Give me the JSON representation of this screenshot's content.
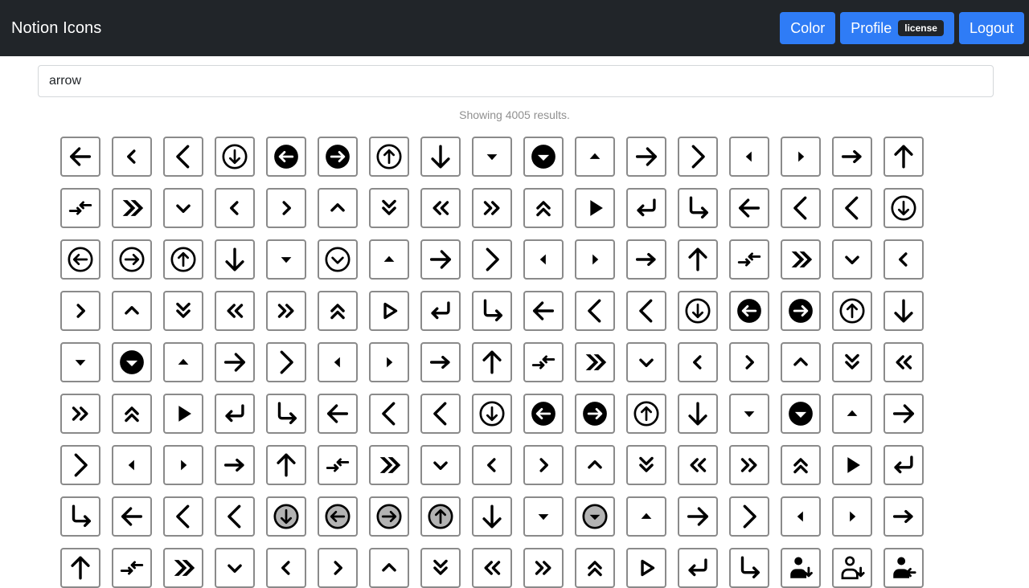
{
  "app": {
    "title": "Notion Icons",
    "nav": {
      "color_label": "Color",
      "profile_label": "Profile",
      "profile_badge": "license",
      "logout_label": "Logout"
    }
  },
  "colors": {
    "navbar": "#212529",
    "button": "#2f7cf6",
    "icon_border": "#8a8a8a",
    "muted_text": "#909090",
    "grey_fill": "#b3b3b3"
  },
  "search": {
    "value": "arrow",
    "placeholder": ""
  },
  "results_text": "Showing 4005 results.",
  "icons": [
    "arrow-left",
    "chevron-left",
    "chevron-left-thin",
    "circle-arrow-down",
    "filled-circle-arrow-left",
    "filled-circle-arrow-right",
    "circle-arrow-up",
    "arrow-down",
    "caret-down",
    "filled-circle-caret-down",
    "caret-up",
    "arrow-right",
    "chevron-right-thin",
    "caret-left",
    "caret-right",
    "arrow-right-short",
    "arrow-up",
    "swap-arrows",
    "double-chevron-bold-right",
    "chevron-down",
    "chevron-left",
    "chevron-right",
    "chevron-up",
    "double-chevron-down",
    "double-chevron-left",
    "double-chevron-right",
    "double-chevron-up",
    "triangle-right",
    "return-arrow",
    "arrow-turn-down-right",
    "arrow-left",
    "chevron-left-thin",
    "chevron-left-thin",
    "circle-arrow-down",
    "circle-arrow-left",
    "circle-arrow-right",
    "circle-arrow-up",
    "arrow-down",
    "caret-down",
    "circle-caret-down",
    "caret-up",
    "arrow-right",
    "chevron-right-thin",
    "caret-left",
    "caret-right",
    "arrow-right-short",
    "arrow-up",
    "swap-arrows",
    "double-chevron-bold-right",
    "chevron-down",
    "chevron-left",
    "chevron-right",
    "chevron-up",
    "double-chevron-down",
    "double-chevron-left",
    "double-chevron-right",
    "double-chevron-up",
    "triangle-right-outline",
    "return-arrow",
    "arrow-turn-down-right",
    "arrow-left",
    "chevron-left-thin",
    "chevron-left-thin",
    "circle-arrow-down",
    "filled-circle-arrow-left",
    "filled-circle-arrow-right",
    "circle-arrow-up",
    "arrow-down",
    "caret-down",
    "filled-circle-caret-down",
    "caret-up",
    "arrow-right",
    "chevron-right-thin",
    "caret-left",
    "caret-right",
    "arrow-right-short",
    "arrow-up",
    "swap-arrows",
    "double-chevron-bold-right",
    "chevron-down",
    "chevron-left",
    "chevron-right",
    "chevron-up",
    "double-chevron-down",
    "double-chevron-left",
    "double-chevron-right",
    "double-chevron-up",
    "triangle-right",
    "return-arrow",
    "arrow-turn-down-right",
    "arrow-left",
    "chevron-left-thin",
    "chevron-left-thin",
    "circle-arrow-down",
    "filled-circle-arrow-left",
    "filled-circle-arrow-right",
    "circle-arrow-up",
    "arrow-down",
    "caret-down",
    "filled-circle-caret-down",
    "caret-up",
    "arrow-right",
    "chevron-right-thin",
    "caret-left",
    "caret-right",
    "arrow-right-short",
    "arrow-up",
    "swap-arrows",
    "double-chevron-bold-right",
    "chevron-down",
    "chevron-left",
    "chevron-right",
    "chevron-up",
    "double-chevron-down",
    "double-chevron-left",
    "double-chevron-right",
    "double-chevron-up",
    "triangle-right",
    "return-arrow",
    "arrow-turn-down-right",
    "arrow-left",
    "chevron-left-thin",
    "chevron-left-thin",
    "grey-circle-arrow-down",
    "grey-circle-arrow-left",
    "grey-circle-arrow-right",
    "grey-circle-arrow-up",
    "arrow-down",
    "caret-down",
    "grey-circle-caret-down",
    "caret-up",
    "arrow-right",
    "chevron-right-thin",
    "caret-left",
    "caret-right",
    "arrow-right-short",
    "arrow-up",
    "swap-arrows",
    "double-chevron-bold-right",
    "chevron-down",
    "chevron-left",
    "chevron-right",
    "chevron-up",
    "double-chevron-down",
    "double-chevron-left",
    "double-chevron-right",
    "double-chevron-up",
    "triangle-right-outline",
    "return-arrow",
    "arrow-turn-down-right",
    "person-arrow-down",
    "person-arrow-down-outline",
    "person-arrow-left"
  ]
}
